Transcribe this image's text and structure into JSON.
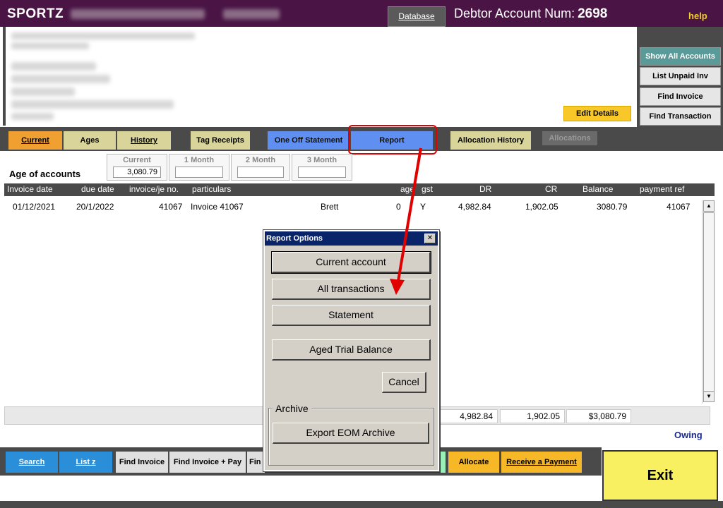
{
  "app": {
    "brand": "SPORTZ",
    "database_label": "Database",
    "debtor_label": "Debtor Account Num:",
    "debtor_num": "2698",
    "help_label": "help"
  },
  "details": {
    "edit_label": "Edit Details"
  },
  "right_buttons": [
    "Show All Accounts",
    "List Unpaid Inv",
    "Find Invoice",
    "Find Transaction"
  ],
  "tabs": {
    "current": "Current",
    "ages": "Ages",
    "history": "History",
    "tag_receipts": "Tag Receipts",
    "one_off": "One Off Statement",
    "report": "Report",
    "allocation_history": "Allocation History",
    "allocations": "Allocations"
  },
  "age": {
    "title": "Age of accounts",
    "buckets": [
      {
        "label": "Current",
        "value": "3,080.79"
      },
      {
        "label": "1 Month",
        "value": ""
      },
      {
        "label": "2 Month",
        "value": ""
      },
      {
        "label": "3 Month",
        "value": ""
      }
    ]
  },
  "grid": {
    "headers": [
      "Invoice date",
      "due date",
      "invoice/je no.",
      "particulars",
      "age",
      "gst",
      "DR",
      "CR",
      "Balance",
      "payment ref"
    ],
    "rows": [
      {
        "invoice_date": "01/12/2021",
        "due_date": "20/1/2022",
        "invoice_no": "41067",
        "particulars": "Invoice 41067",
        "name": "Brett",
        "age": "0",
        "gst": "Y",
        "dr": "4,982.84",
        "cr": "1,902.05",
        "balance": "3080.79",
        "payment_ref": "41067"
      }
    ]
  },
  "totals": {
    "dr": "4,982.84",
    "cr": "1,902.05",
    "balance": "$3,080.79",
    "owing_label": "Owing"
  },
  "bottom_buttons": {
    "search": "Search",
    "list_z": "List z",
    "find_invoice": "Find Invoice",
    "find_invoice_pay": "Find Invoice + Pay",
    "find_partial": "Fin",
    "allocate": "Allocate",
    "receive_payment": "Receive a Payment",
    "exit": "Exit"
  },
  "dialog": {
    "title": "Report Options",
    "close_glyph": "✕",
    "buttons": [
      "Current account",
      "All transactions",
      "Statement",
      "Aged Trial Balance"
    ],
    "cancel": "Cancel",
    "archive_label": "Archive",
    "export": "Export EOM Archive"
  },
  "colors": {
    "header_bg": "#4a1545",
    "dark_gray": "#4a4a4a",
    "accent_blue": "#5f8ff0",
    "annotation_red": "#e00000"
  }
}
